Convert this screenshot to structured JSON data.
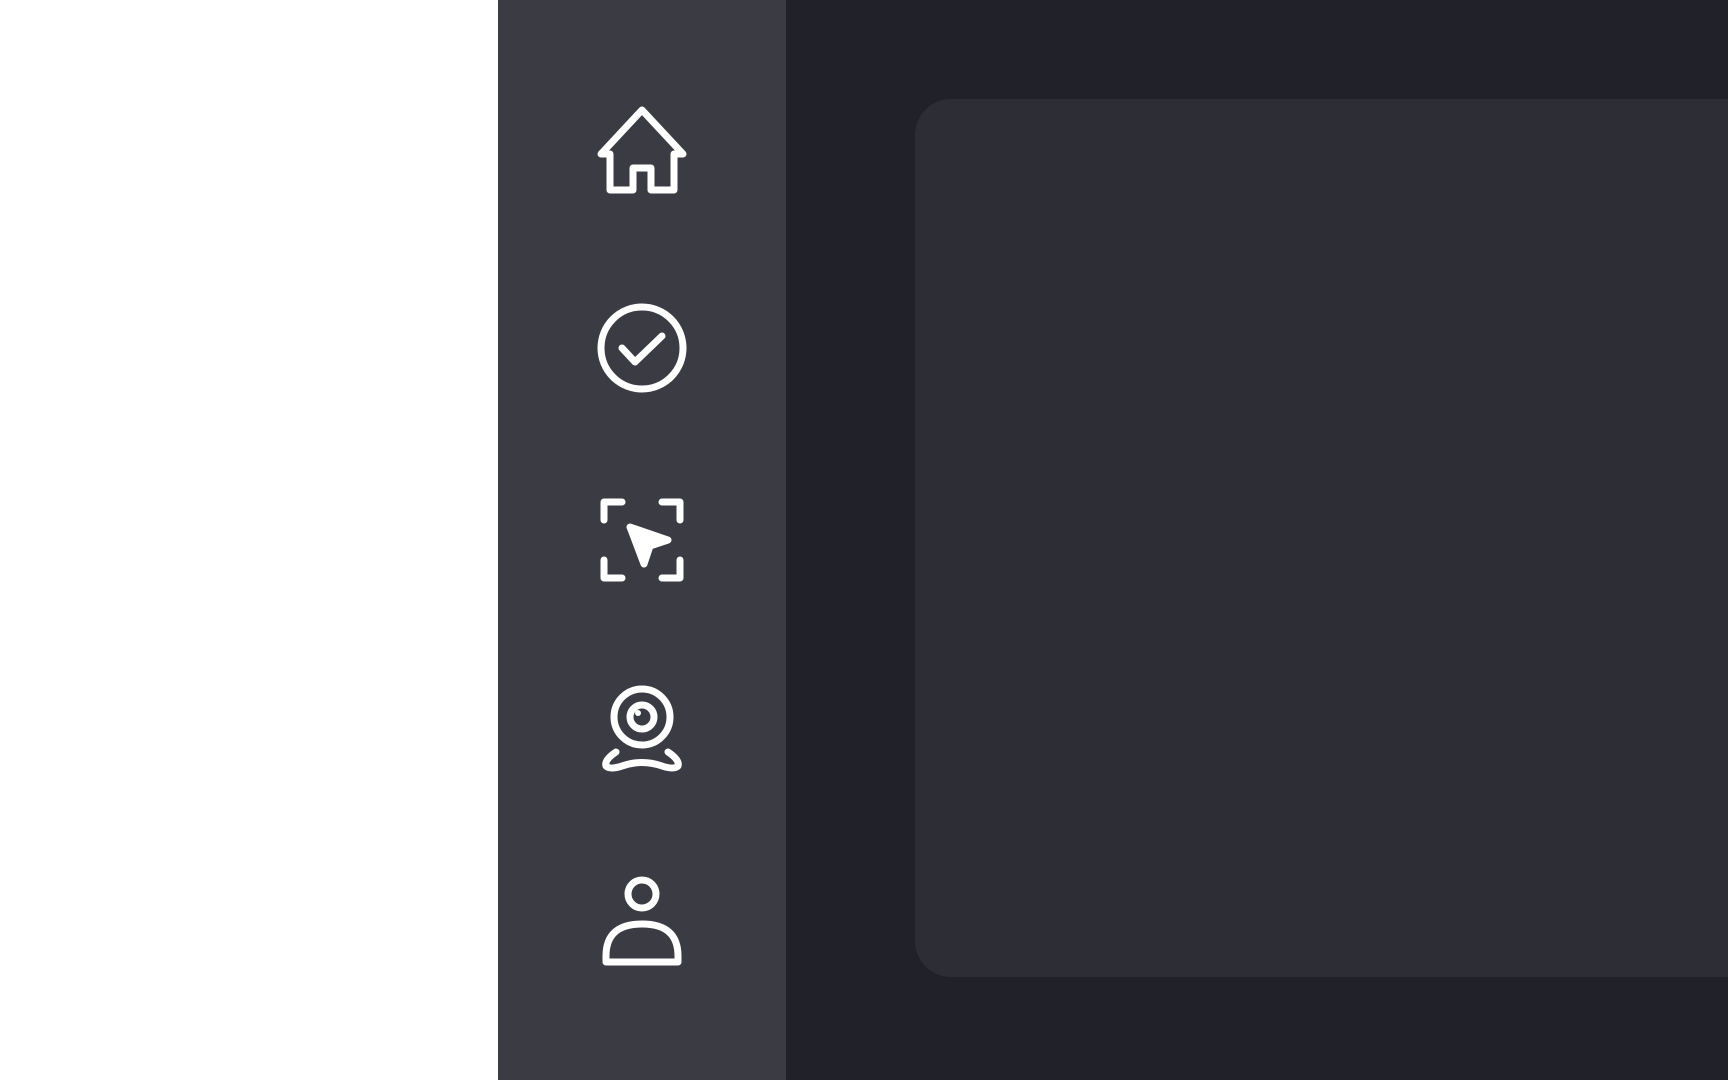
{
  "theme": {
    "sidebar_bg": "#3b3b44",
    "main_bg": "#212129",
    "panel_bg": "#2d2d36",
    "icon_color": "#ffffff"
  },
  "sidebar": {
    "items": [
      {
        "id": "home",
        "icon": "home-icon"
      },
      {
        "id": "tasks",
        "icon": "check-circle-icon"
      },
      {
        "id": "capture",
        "icon": "screen-capture-cursor-icon"
      },
      {
        "id": "webcam",
        "icon": "webcam-icon"
      },
      {
        "id": "profile",
        "icon": "user-icon"
      }
    ]
  },
  "main": {
    "panel": {}
  }
}
